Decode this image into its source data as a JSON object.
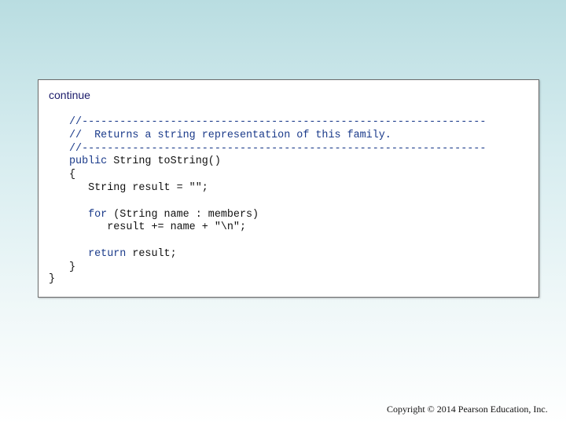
{
  "heading": "continue",
  "code": {
    "line1": "//----------------------------------------------------------------",
    "line2": "//  Returns a string representation of this family.",
    "line3": "//----------------------------------------------------------------",
    "line4_kw": "public",
    "line4_rest": " String toString()",
    "line5": "{",
    "line6": "   String result = \"\";",
    "line7": "",
    "line8_indent": "   ",
    "line8_kw": "for",
    "line8_rest": " (String name : members)",
    "line9": "      result += name + \"\\n\";",
    "line10": "",
    "line11_indent": "   ",
    "line11_kw": "return",
    "line11_rest": " result;",
    "line12": "}"
  },
  "closing_brace": "}",
  "footer": {
    "copyright": "Copyright © 2014 Pearson Education, Inc."
  },
  "colors": {
    "keyword": "#1a3a8a",
    "comment": "#1a3a8a",
    "heading": "#1a1a6a"
  }
}
